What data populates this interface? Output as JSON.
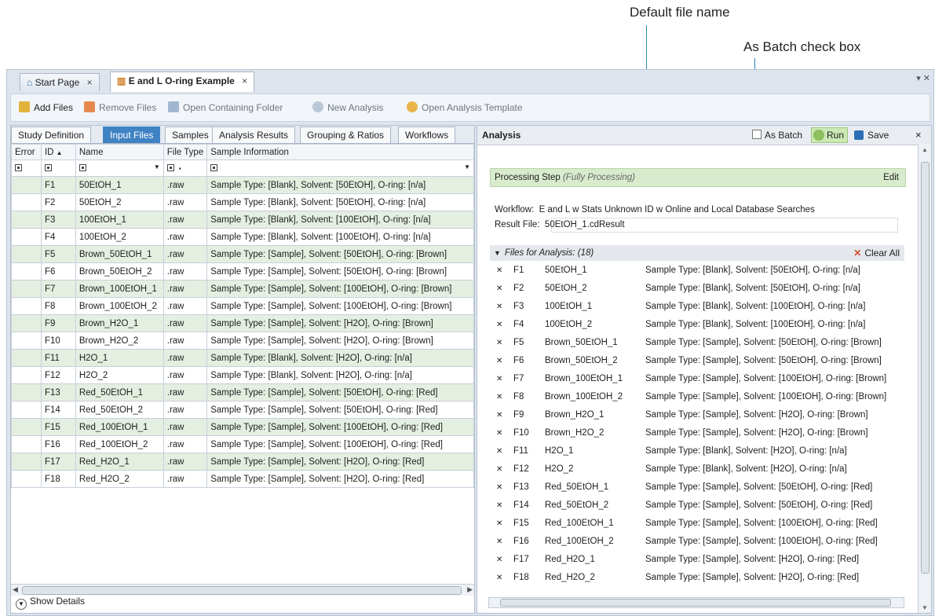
{
  "callouts": {
    "default_file_name": "Default file name",
    "as_batch_check_box": "As Batch check box"
  },
  "tabs": [
    {
      "label": "Start Page",
      "close": "×"
    },
    {
      "label": "E and L O-ring Example",
      "close": "×"
    }
  ],
  "toolbar": {
    "add_files": "Add Files",
    "remove_files": "Remove Files",
    "open_folder": "Open Containing Folder",
    "new_analysis": "New Analysis",
    "open_template": "Open Analysis Template"
  },
  "subtabs": [
    "Study Definition",
    "Input Files",
    "Samples",
    "Analysis Results",
    "Grouping & Ratios",
    "Workflows"
  ],
  "grid": {
    "headers": {
      "error": "Error",
      "id": "ID",
      "name": "Name",
      "file_type": "File Type",
      "sample_info": "Sample Information"
    },
    "sort_arrow": "▲",
    "rows": [
      {
        "id": "F1",
        "name": "50EtOH_1",
        "type": ".raw",
        "info": "Sample Type: [Blank], Solvent: [50EtOH], O-ring: [n/a]"
      },
      {
        "id": "F2",
        "name": "50EtOH_2",
        "type": ".raw",
        "info": "Sample Type: [Blank], Solvent: [50EtOH], O-ring: [n/a]"
      },
      {
        "id": "F3",
        "name": "100EtOH_1",
        "type": ".raw",
        "info": "Sample Type: [Blank], Solvent: [100EtOH], O-ring: [n/a]"
      },
      {
        "id": "F4",
        "name": "100EtOH_2",
        "type": ".raw",
        "info": "Sample Type: [Blank], Solvent: [100EtOH], O-ring: [n/a]"
      },
      {
        "id": "F5",
        "name": "Brown_50EtOH_1",
        "type": ".raw",
        "info": "Sample Type: [Sample], Solvent: [50EtOH], O-ring: [Brown]"
      },
      {
        "id": "F6",
        "name": "Brown_50EtOH_2",
        "type": ".raw",
        "info": "Sample Type: [Sample], Solvent: [50EtOH], O-ring: [Brown]"
      },
      {
        "id": "F7",
        "name": "Brown_100EtOH_1",
        "type": ".raw",
        "info": "Sample Type: [Sample], Solvent: [100EtOH], O-ring: [Brown]"
      },
      {
        "id": "F8",
        "name": "Brown_100EtOH_2",
        "type": ".raw",
        "info": "Sample Type: [Sample], Solvent: [100EtOH], O-ring: [Brown]"
      },
      {
        "id": "F9",
        "name": "Brown_H2O_1",
        "type": ".raw",
        "info": "Sample Type: [Sample], Solvent: [H2O], O-ring: [Brown]"
      },
      {
        "id": "F10",
        "name": "Brown_H2O_2",
        "type": ".raw",
        "info": "Sample Type: [Sample], Solvent: [H2O], O-ring: [Brown]"
      },
      {
        "id": "F11",
        "name": "H2O_1",
        "type": ".raw",
        "info": "Sample Type: [Blank], Solvent: [H2O], O-ring: [n/a]"
      },
      {
        "id": "F12",
        "name": "H2O_2",
        "type": ".raw",
        "info": "Sample Type: [Blank], Solvent: [H2O], O-ring: [n/a]"
      },
      {
        "id": "F13",
        "name": "Red_50EtOH_1",
        "type": ".raw",
        "info": "Sample Type: [Sample], Solvent: [50EtOH], O-ring: [Red]"
      },
      {
        "id": "F14",
        "name": "Red_50EtOH_2",
        "type": ".raw",
        "info": "Sample Type: [Sample], Solvent: [50EtOH], O-ring: [Red]"
      },
      {
        "id": "F15",
        "name": "Red_100EtOH_1",
        "type": ".raw",
        "info": "Sample Type: [Sample], Solvent: [100EtOH], O-ring: [Red]"
      },
      {
        "id": "F16",
        "name": "Red_100EtOH_2",
        "type": ".raw",
        "info": "Sample Type: [Sample], Solvent: [100EtOH], O-ring: [Red]"
      },
      {
        "id": "F17",
        "name": "Red_H2O_1",
        "type": ".raw",
        "info": "Sample Type: [Sample], Solvent: [H2O], O-ring: [Red]"
      },
      {
        "id": "F18",
        "name": "Red_H2O_2",
        "type": ".raw",
        "info": "Sample Type: [Sample], Solvent: [H2O], O-ring: [Red]"
      }
    ]
  },
  "show_details": "Show Details",
  "analysis": {
    "title": "Analysis",
    "as_batch": "As Batch",
    "run": "Run",
    "save": "Save",
    "close": "×",
    "processing_step": "Processing Step",
    "processing_state": "(Fully Processing)",
    "edit": "Edit",
    "workflow_label": "Workflow:",
    "workflow_value": "E and L w Stats Unknown ID w Online and Local Database Searches",
    "result_label": "Result File:",
    "result_value": "50EtOH_1.cdResult",
    "files_header": "Files for Analysis: (18)",
    "clear_all": "Clear All"
  },
  "colors": {
    "accent": "#3f83c4",
    "row_alt": "#e5efe1",
    "step_bg": "#d8ebcd",
    "callout_line": "#2a8ab8"
  }
}
